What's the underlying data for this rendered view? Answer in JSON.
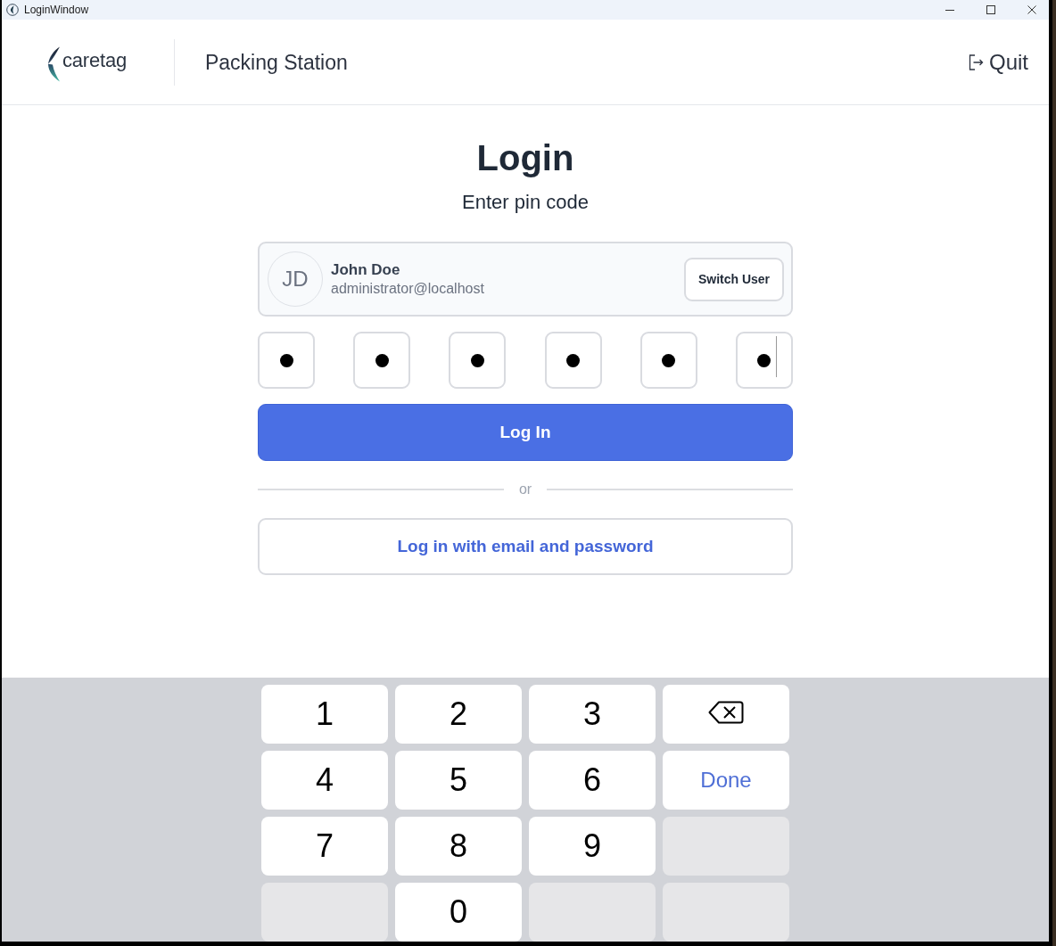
{
  "window": {
    "title": "LoginWindow"
  },
  "header": {
    "logo_text": "caretag",
    "station": "Packing Station",
    "quit_label": "Quit"
  },
  "login": {
    "title": "Login",
    "subtitle": "Enter pin code"
  },
  "user": {
    "initials": "JD",
    "name": "John Doe",
    "email": "administrator@localhost",
    "switch_label": "Switch User"
  },
  "pin": {
    "boxes": [
      {
        "filled": true,
        "focused": false
      },
      {
        "filled": true,
        "focused": false
      },
      {
        "filled": true,
        "focused": false
      },
      {
        "filled": true,
        "focused": false
      },
      {
        "filled": true,
        "focused": false
      },
      {
        "filled": true,
        "focused": true
      }
    ]
  },
  "login_button": "Log In",
  "divider": "or",
  "alt_login_button": "Log in with email and password",
  "keypad": {
    "keys": [
      {
        "kind": "digit",
        "label": "1"
      },
      {
        "kind": "digit",
        "label": "2"
      },
      {
        "kind": "digit",
        "label": "3"
      },
      {
        "kind": "backspace"
      },
      {
        "kind": "digit",
        "label": "4"
      },
      {
        "kind": "digit",
        "label": "5"
      },
      {
        "kind": "digit",
        "label": "6"
      },
      {
        "kind": "done",
        "label": "Done"
      },
      {
        "kind": "digit",
        "label": "7"
      },
      {
        "kind": "digit",
        "label": "8"
      },
      {
        "kind": "digit",
        "label": "9"
      },
      {
        "kind": "blank"
      },
      {
        "kind": "blank"
      },
      {
        "kind": "digit",
        "label": "0"
      },
      {
        "kind": "blank"
      },
      {
        "kind": "blank"
      }
    ]
  }
}
